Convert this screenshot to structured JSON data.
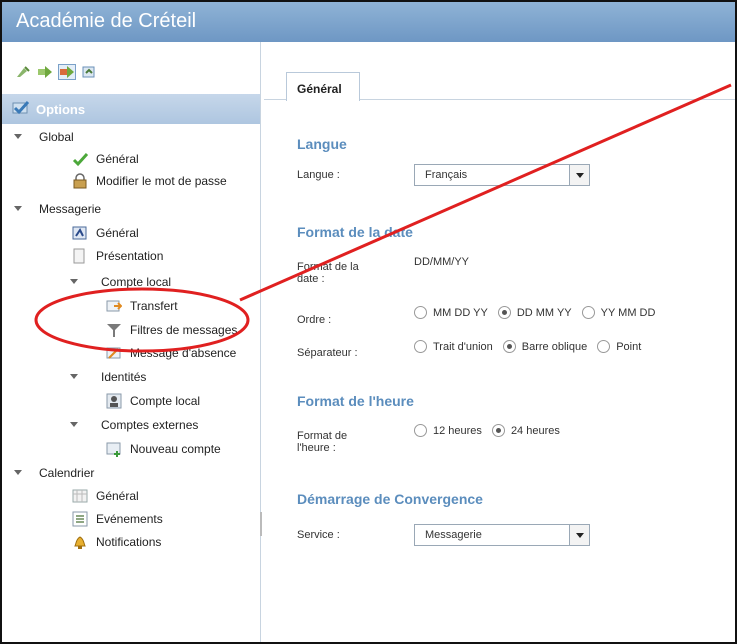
{
  "app": {
    "title": "Académie de Créteil"
  },
  "toolbar": {
    "icons": [
      "new-task-icon",
      "forward-icon",
      "move-icon",
      "import-icon"
    ]
  },
  "sidebar": {
    "header": "Options",
    "items": [
      {
        "label": "Global",
        "icon": "triangle"
      },
      {
        "label": "Général",
        "icon": "checkmark-icon"
      },
      {
        "label": "Modifier le mot de passe",
        "icon": "lock-icon"
      },
      {
        "label": "Messagerie",
        "icon": "triangle"
      },
      {
        "label": "Général",
        "icon": "settings-icon"
      },
      {
        "label": "Présentation",
        "icon": "layout-icon"
      },
      {
        "label": "Compte local",
        "icon": "triangle"
      },
      {
        "label": "Transfert",
        "icon": "transfer-icon"
      },
      {
        "label": "Filtres de messages",
        "icon": "filter-icon"
      },
      {
        "label": "Message d'absence",
        "icon": "absence-icon"
      },
      {
        "label": "Identités",
        "icon": "triangle"
      },
      {
        "label": "Compte local",
        "icon": "user-icon"
      },
      {
        "label": "Comptes externes",
        "icon": "triangle"
      },
      {
        "label": "Nouveau compte",
        "icon": "add-account-icon"
      },
      {
        "label": "Calendrier",
        "icon": "triangle"
      },
      {
        "label": "Général",
        "icon": "calendar-icon"
      },
      {
        "label": "Evénements",
        "icon": "list-icon"
      },
      {
        "label": "Notifications",
        "icon": "bell-icon"
      }
    ]
  },
  "main": {
    "tab": "Général",
    "langue": {
      "title": "Langue",
      "label": "Langue :",
      "value": "Français"
    },
    "date": {
      "title": "Format de la date",
      "format_label": "Format de la date :",
      "format_value": "DD/MM/YY",
      "ordre_label": "Ordre :",
      "ordre_options": [
        "MM DD YY",
        "DD MM YY",
        "YY MM DD"
      ],
      "ordre_selected": "DD MM YY",
      "sep_label": "Séparateur :",
      "sep_options": [
        "Trait d'union",
        "Barre oblique",
        "Point"
      ],
      "sep_selected": "Barre oblique"
    },
    "heure": {
      "title": "Format de l'heure",
      "label": "Format de l'heure :",
      "options": [
        "12 heures",
        "24 heures"
      ],
      "selected": "24 heures"
    },
    "demarrage": {
      "title": "Démarrage de Convergence",
      "label": "Service :",
      "value": "Messagerie"
    }
  },
  "annotation": {
    "color": "#e02020"
  }
}
